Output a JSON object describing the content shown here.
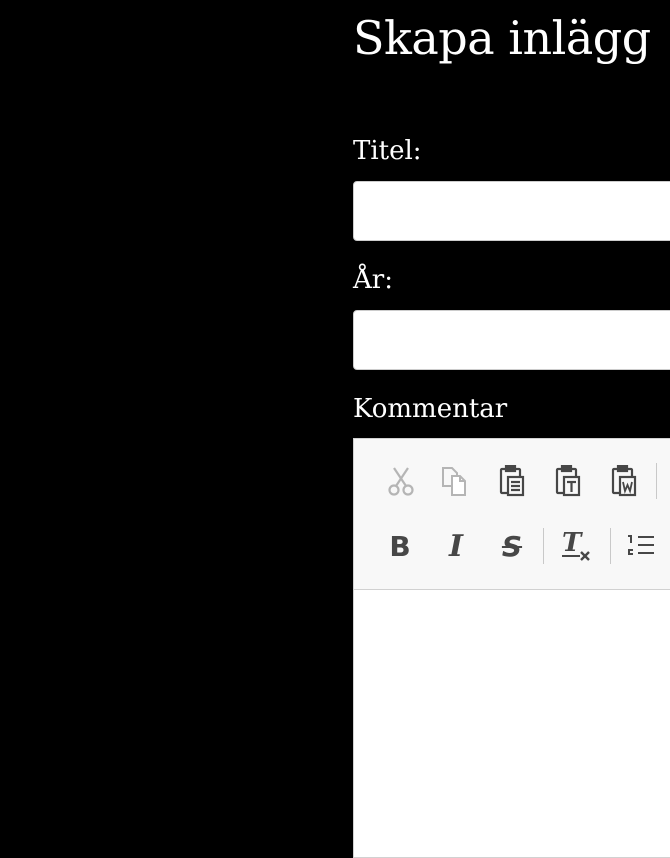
{
  "page": {
    "title": "Skapa inlägg"
  },
  "form": {
    "title_label": "Titel:",
    "title_value": "",
    "year_label": "År:",
    "year_value": "",
    "comment_label": "Kommentar"
  },
  "editor": {
    "toolbar_row1": [
      {
        "name": "cut",
        "icon": "scissors-icon",
        "enabled": false
      },
      {
        "name": "copy",
        "icon": "copy-icon",
        "enabled": false
      },
      {
        "name": "paste",
        "icon": "paste-icon",
        "enabled": true
      },
      {
        "name": "paste-as-text",
        "icon": "paste-text-icon",
        "enabled": true
      },
      {
        "name": "paste-from-word",
        "icon": "paste-word-icon",
        "enabled": true
      }
    ],
    "toolbar_row2": [
      {
        "name": "bold",
        "icon": "bold-icon",
        "glyph": "B"
      },
      {
        "name": "italic",
        "icon": "italic-icon",
        "glyph": "I"
      },
      {
        "name": "strike",
        "icon": "strikethrough-icon",
        "glyph": "S"
      },
      {
        "name": "remove-format",
        "icon": "remove-format-icon",
        "glyph": "T"
      },
      {
        "name": "numbered-list",
        "icon": "numbered-list-icon"
      }
    ],
    "content": ""
  },
  "colors": {
    "background": "#000000",
    "toolbar_bg": "#f8f8f8",
    "icon_enabled": "#474747",
    "icon_disabled": "#b5b5b5"
  }
}
